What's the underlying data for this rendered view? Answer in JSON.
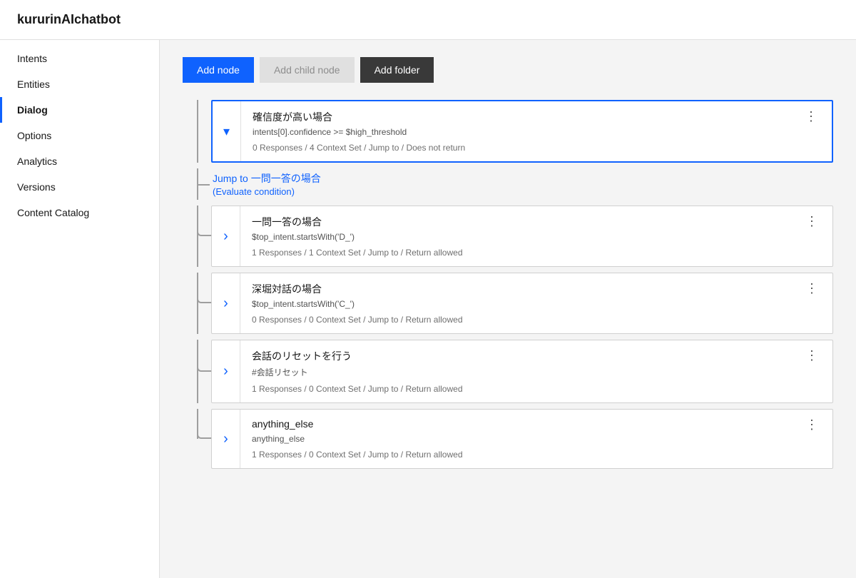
{
  "app": {
    "title": "kururinAIchatbot"
  },
  "sidebar": {
    "items": [
      {
        "id": "intents",
        "label": "Intents",
        "active": false
      },
      {
        "id": "entities",
        "label": "Entities",
        "active": false
      },
      {
        "id": "dialog",
        "label": "Dialog",
        "active": true
      },
      {
        "id": "options",
        "label": "Options",
        "active": false
      },
      {
        "id": "analytics",
        "label": "Analytics",
        "active": false
      },
      {
        "id": "versions",
        "label": "Versions",
        "active": false
      },
      {
        "id": "content-catalog",
        "label": "Content Catalog",
        "active": false
      }
    ]
  },
  "toolbar": {
    "add_node_label": "Add node",
    "add_child_node_label": "Add child node",
    "add_folder_label": "Add folder"
  },
  "nodes": [
    {
      "id": "node1",
      "title": "確信度が高い場合",
      "condition": "intents[0].confidence >= $high_threshold",
      "meta": "0 Responses / 4 Context Set / Jump to / Does not return",
      "expanded": true,
      "highlighted": true,
      "toggle_icon": "▾"
    }
  ],
  "jump_link": {
    "prefix": "Jump to",
    "text": "一問一答の場合",
    "suffix": "(Evaluate condition)"
  },
  "child_nodes": [
    {
      "id": "child1",
      "title": "一問一答の場合",
      "condition": "$top_intent.startsWith('D_')",
      "meta": "1 Responses / 1 Context Set / Jump to / Return allowed",
      "toggle_icon": "›"
    },
    {
      "id": "child2",
      "title": "深堀対話の場合",
      "condition": "$top_intent.startsWith('C_')",
      "meta": "0 Responses / 0 Context Set / Jump to / Return allowed",
      "toggle_icon": "›"
    },
    {
      "id": "child3",
      "title": "会話のリセットを行う",
      "condition": "#会話リセット",
      "meta": "1 Responses / 0 Context Set / Jump to / Return allowed",
      "toggle_icon": "›"
    },
    {
      "id": "child4",
      "title": "anything_else",
      "condition": "anything_else",
      "meta": "1 Responses / 0 Context Set / Jump to / Return allowed",
      "toggle_icon": "›"
    }
  ],
  "menu_icon": "⋮"
}
